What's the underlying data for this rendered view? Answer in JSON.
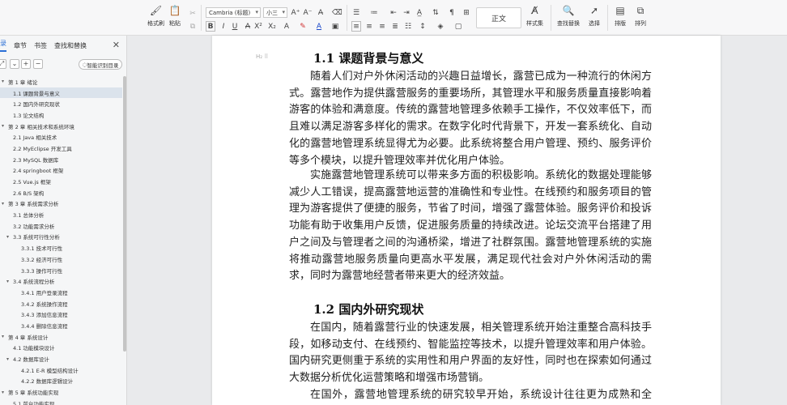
{
  "toolbar": {
    "format_painter": "格式刷",
    "paste": "粘贴",
    "font_name": "Cambria (标题)",
    "font_size": "小三",
    "style_preview": "正文",
    "styles_set": "样式集",
    "find_replace": "查找替换",
    "select": "选择",
    "layout": "排版",
    "arrange": "排列"
  },
  "nav": {
    "tabs": [
      "目录",
      "章节",
      "书签",
      "查找和替换"
    ],
    "smart_toc": "智能识别目录",
    "toc": [
      {
        "label": "第 1 章  绪论",
        "level": 0,
        "arrow": "▾",
        "active": false
      },
      {
        "label": "1.1 课题背景与意义",
        "level": 1,
        "arrow": "",
        "active": true
      },
      {
        "label": "1.2 国内外研究现状",
        "level": 1,
        "arrow": "",
        "active": false
      },
      {
        "label": "1.3 论文结构",
        "level": 1,
        "arrow": "",
        "active": false
      },
      {
        "label": "第 2 章  相关技术和系统环境",
        "level": 0,
        "arrow": "▾",
        "active": false
      },
      {
        "label": "2.1 Java 相关技术",
        "level": 1,
        "arrow": "",
        "active": false
      },
      {
        "label": "2.2 MyEclipse 开发工具",
        "level": 1,
        "arrow": "",
        "active": false
      },
      {
        "label": "2.3 MySQL 数据库",
        "level": 1,
        "arrow": "",
        "active": false
      },
      {
        "label": "2.4 springboot 框架",
        "level": 1,
        "arrow": "",
        "active": false
      },
      {
        "label": "2.5 Vue.js 框架",
        "level": 1,
        "arrow": "",
        "active": false
      },
      {
        "label": "2.6 B/S 架构",
        "level": 1,
        "arrow": "",
        "active": false
      },
      {
        "label": "第 3 章  系统需求分析",
        "level": 0,
        "arrow": "▾",
        "active": false
      },
      {
        "label": "3.1 总体分析",
        "level": 1,
        "arrow": "",
        "active": false
      },
      {
        "label": "3.2 功能需求分析",
        "level": 1,
        "arrow": "",
        "active": false
      },
      {
        "label": "3.3  系统可行性分析",
        "level": 1,
        "arrow": "▾",
        "active": false
      },
      {
        "label": "3.3.1 技术可行性",
        "level": 2,
        "arrow": "",
        "active": false
      },
      {
        "label": "3.3.2 经济可行性",
        "level": 2,
        "arrow": "",
        "active": false
      },
      {
        "label": "3.3.3 操作可行性",
        "level": 2,
        "arrow": "",
        "active": false
      },
      {
        "label": "3.4 系统流程分析",
        "level": 1,
        "arrow": "▾",
        "active": false
      },
      {
        "label": "3.4.1  用户登录流程",
        "level": 2,
        "arrow": "",
        "active": false
      },
      {
        "label": "3.4.2  系统操作流程",
        "level": 2,
        "arrow": "",
        "active": false
      },
      {
        "label": "3.4.3 添加信息流程",
        "level": 2,
        "arrow": "",
        "active": false
      },
      {
        "label": "3.4.4 删除信息流程",
        "level": 2,
        "arrow": "",
        "active": false
      },
      {
        "label": "第 4 章  系统设计",
        "level": 0,
        "arrow": "▾",
        "active": false
      },
      {
        "label": "4.1  功能模块设计",
        "level": 1,
        "arrow": "",
        "active": false
      },
      {
        "label": "4.2  数据库设计",
        "level": 1,
        "arrow": "▾",
        "active": false
      },
      {
        "label": "4.2.1 E-R 模型结构设计",
        "level": 2,
        "arrow": "",
        "active": false
      },
      {
        "label": "4.2.2  数据库逻辑设计",
        "level": 2,
        "arrow": "",
        "active": false
      },
      {
        "label": "第 5 章  系统功能实现",
        "level": 0,
        "arrow": "▾",
        "active": false
      },
      {
        "label": "5.1 前台功能实现",
        "level": 1,
        "arrow": "",
        "active": false
      }
    ]
  },
  "doc": {
    "handle": "H₂ ⠿",
    "h1": "1.1 课题背景与意义",
    "p1": "随着人们对户外休闲活动的兴趣日益增长，露营已成为一种流行的休闲方式。露营地作为提供露营服务的重要场所，其管理水平和服务质量直接影响着游客的体验和满意度。传统的露营地管理多依赖手工操作，不仅效率低下，而且难以满足游客多样化的需求。在数字化时代背景下，开发一套系统化、自动化的露营地管理系统显得尤为必要。此系统将整合用户管理、预约、服务评价等多个模块，以提升管理效率并优化用户体验。",
    "p2": "实施露营地管理系统可以带来多方面的积极影响。系统化的数据处理能够减少人工错误，提高露营地运营的准确性和专业性。在线预约和服务项目的管理为游客提供了便捷的服务，节省了时间，增强了露营体验。服务评价和投诉功能有助于收集用户反馈，促进服务质量的持续改进。论坛交流平台搭建了用户之间及与管理者之间的沟通桥梁，增进了社群氛围。露营地管理系统的实施将推动露营地服务质量向更高水平发展，满足现代社会对户外休闲活动的需求，同时为露营地经营者带来更大的经济效益。",
    "h2": "1.2 国内外研究现状",
    "p3": "在国内，随着露营行业的快速发展，相关管理系统开始注重整合高科技手段，如移动支付、在线预约、智能监控等技术，以提升管理效率和用户体验。国内研究更侧重于系统的实用性和用户界面的友好性，同时也在探索如何通过大数据分析优化运营策略和增强市场营销。",
    "p4": "在国外，露营地管理系统的研究较早开始，系统设计往往更为成熟和全面，"
  },
  "colors": {
    "accent": "#2a6fd6",
    "active_row": "#dbe3ec"
  }
}
